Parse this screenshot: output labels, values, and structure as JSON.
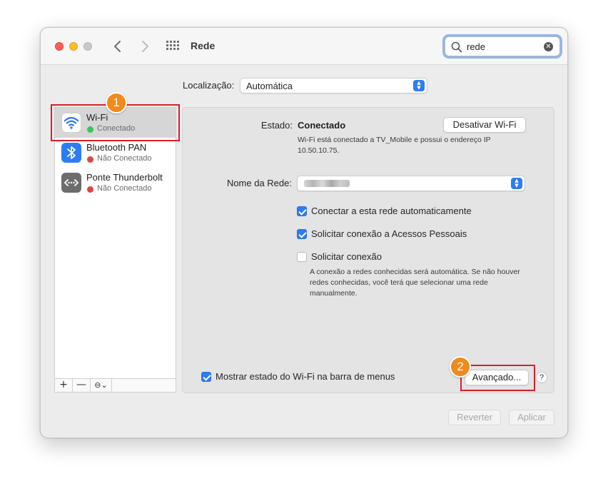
{
  "window": {
    "title": "Rede"
  },
  "search": {
    "value": "rede"
  },
  "location": {
    "label": "Localização:",
    "value": "Automática"
  },
  "services": [
    {
      "name": "Wi-Fi",
      "status": "Conectado",
      "status_color": "#34c759",
      "icon": "wifi-icon"
    },
    {
      "name": "Bluetooth PAN",
      "status": "Não Conectado",
      "status_color": "#e0443e",
      "icon": "bluetooth-icon"
    },
    {
      "name": "Ponte Thunderbolt",
      "status": "Não Conectado",
      "status_color": "#e0443e",
      "icon": "thunderbolt-bridge-icon"
    }
  ],
  "sidebar_footer": {
    "add": "+",
    "remove": "—",
    "action": "⊖⌄"
  },
  "detail": {
    "status_label": "Estado:",
    "status_value": "Conectado",
    "turn_off_button": "Desativar Wi-Fi",
    "status_description": [
      "Wi-Fi está conectado a TV_Mobile e possui o endereço IP",
      "10.50.10.75."
    ],
    "network_name_label": "Nome da Rede:",
    "options": [
      {
        "label": "Conectar a esta rede automaticamente",
        "checked": true
      },
      {
        "label": "Solicitar conexão a Acessos Pessoais",
        "checked": true
      },
      {
        "label": "Solicitar conexão",
        "checked": false
      }
    ],
    "ask_description": [
      "A conexão a redes conhecidas será automática. Se não houver",
      "redes conhecidas, você terá que selecionar uma rede",
      "manualmente."
    ],
    "show_status_label": "Mostrar estado do Wi-Fi na barra de menus",
    "show_status_checked": true,
    "advanced_button": "Avançado...",
    "help": "?"
  },
  "footer": {
    "revert": "Reverter",
    "apply": "Aplicar"
  },
  "annotations": {
    "step1": "1",
    "step2": "2",
    "highlight_color": "#d8202c",
    "badge_color": "#f08a1c"
  },
  "colors": {
    "accent": "#2d7cf6"
  }
}
